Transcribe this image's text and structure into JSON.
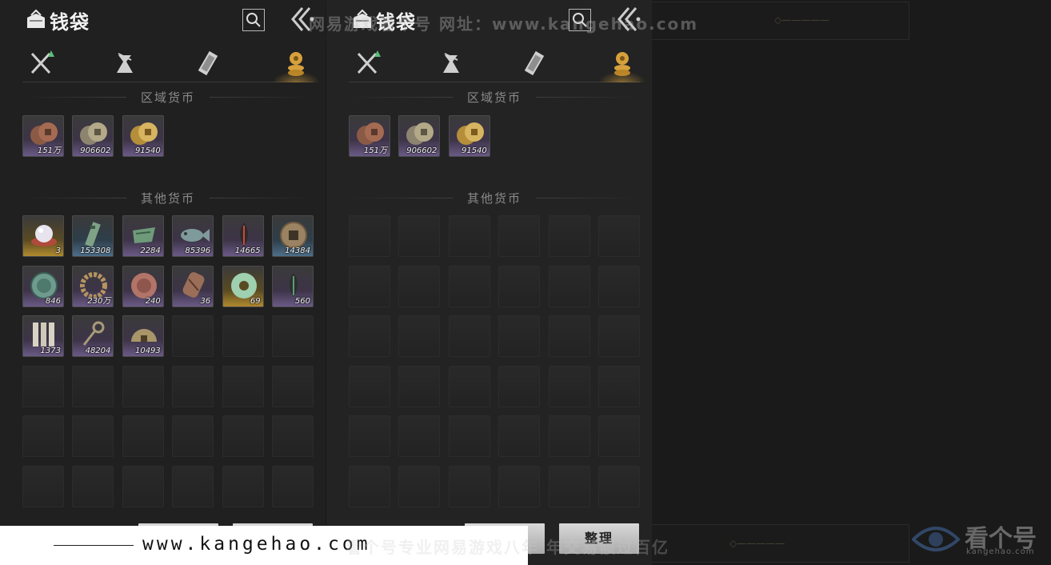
{
  "title": "钱袋",
  "sections": {
    "regional": "区域货币",
    "other": "其他货币"
  },
  "tabs": [
    {
      "id": "equipment",
      "icon": "crossed-swords-icon",
      "active": false
    },
    {
      "id": "materials",
      "icon": "pouch-icon",
      "active": false
    },
    {
      "id": "scrolls",
      "icon": "scroll-icon",
      "active": false
    },
    {
      "id": "currency",
      "icon": "coin-stack-icon",
      "active": true
    }
  ],
  "regional_currency": [
    {
      "name": "copper-coins",
      "count": "151万",
      "rarity": "purple"
    },
    {
      "name": "silver-coins",
      "count": "906602",
      "rarity": "purple"
    },
    {
      "name": "gold-coins",
      "count": "91540",
      "rarity": "purple"
    }
  ],
  "other_currency": [
    {
      "name": "pearl",
      "count": "3",
      "rarity": "gold"
    },
    {
      "name": "jade-token",
      "count": "153308",
      "rarity": "blue"
    },
    {
      "name": "green-cloth",
      "count": "2284",
      "rarity": "purple"
    },
    {
      "name": "jade-fish",
      "count": "85396",
      "rarity": "purple"
    },
    {
      "name": "red-feather",
      "count": "14665",
      "rarity": "purple"
    },
    {
      "name": "bronze-coin",
      "count": "14384",
      "rarity": "blue"
    },
    {
      "name": "jade-medallion",
      "count": "846",
      "rarity": "purple"
    },
    {
      "name": "bead-bracelet",
      "count": "230万",
      "rarity": "purple"
    },
    {
      "name": "red-medallion",
      "count": "240",
      "rarity": "purple"
    },
    {
      "name": "carved-tablet",
      "count": "36",
      "rarity": "purple"
    },
    {
      "name": "jade-disc",
      "count": "69",
      "rarity": "gold"
    },
    {
      "name": "green-feather",
      "count": "560",
      "rarity": "purple"
    },
    {
      "name": "bamboo-slips",
      "count": "1373",
      "rarity": "purple"
    },
    {
      "name": "key-token",
      "count": "48204",
      "rarity": "purple"
    },
    {
      "name": "half-coin",
      "count": "10493",
      "rarity": "purple"
    }
  ],
  "buttons": {
    "sort": "整理"
  },
  "watermarks": {
    "url": "www.kangehao.com",
    "top": "网易游戏看个号 网址：www.kangehao.com",
    "bottom": "看个号专业网易游戏八年 年交易额过百亿",
    "logo": "看个号",
    "logo_sub": "kangehao.com"
  },
  "colors": {
    "active_tab_glow": "#d6a03c",
    "rarity_purple": "#6a5a86",
    "rarity_gold": "#b08a2e",
    "rarity_blue": "#4d6f8a"
  }
}
